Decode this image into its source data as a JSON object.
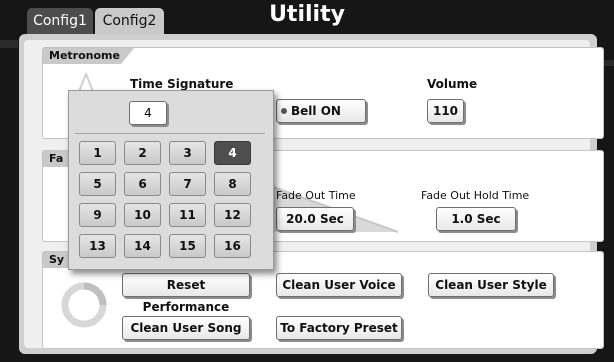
{
  "tabs": [
    {
      "label": "Config1",
      "active": true
    },
    {
      "label": "Config2",
      "active": false
    }
  ],
  "title": "Utility",
  "metronome": {
    "section_label": "Metronome",
    "time_signature_label": "Time Signature",
    "bell_label": "Bell ON",
    "volume_label": "Volume",
    "volume_value": "110"
  },
  "fade": {
    "section_label": "Fa",
    "fade_out_time_label": "Fade Out Time",
    "fade_out_time_value": "20.0 Sec",
    "fade_out_hold_label": "Fade Out Hold Time",
    "fade_out_hold_value": "1.0 Sec"
  },
  "system": {
    "section_label": "Sy",
    "reset_performance": "Reset Performance",
    "clean_user_voice": "Clean User Voice",
    "clean_user_style": "Clean User Style",
    "clean_user_song": "Clean User Song",
    "to_factory_preset": "To Factory Preset"
  },
  "time_signature_popup": {
    "current_value": "4",
    "options": [
      "1",
      "2",
      "3",
      "4",
      "5",
      "6",
      "7",
      "8",
      "9",
      "10",
      "11",
      "12",
      "13",
      "14",
      "15",
      "16"
    ],
    "selected": "4"
  },
  "colors": {
    "selected_key": "#4e4e4e",
    "background": "#161616"
  }
}
